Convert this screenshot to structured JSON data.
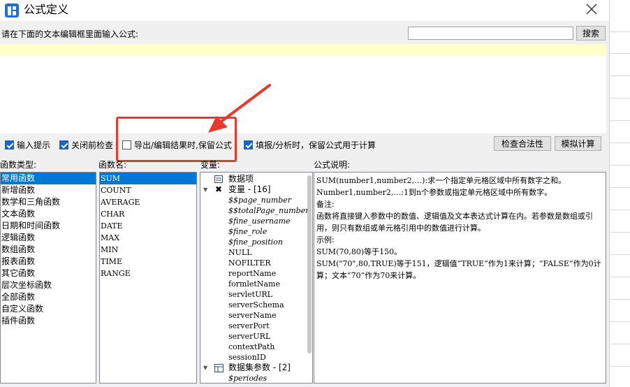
{
  "window": {
    "title": "公式定义"
  },
  "prompt": "请在下面的文本编辑框里面输入公式:",
  "search": {
    "value": "",
    "placeholder": "",
    "button": "搜索"
  },
  "options": {
    "input_hint": {
      "label": "输入提示",
      "checked": true
    },
    "check_before_close": {
      "label": "关闭前检查",
      "checked": true
    },
    "keep_formula_export": {
      "label": "导出/编辑结果时,保留公式",
      "checked": false
    },
    "keep_formula_fill": {
      "label": "填报/分析时，保留公式用于计算",
      "checked": true
    }
  },
  "buttons": {
    "check_validity": "检查合法性",
    "simulate": "模拟计算"
  },
  "headers": {
    "func_type": "函数类型:",
    "func_name": "函数名:",
    "variable": "变量:",
    "formula_desc": "公式说明:"
  },
  "func_types": [
    "常用函数",
    "新增函数",
    "数学和三角函数",
    "文本函数",
    "日期和时间函数",
    "逻辑函数",
    "数组函数",
    "报表函数",
    "其它函数",
    "层次坐标函数",
    "全部函数",
    "自定义函数",
    "插件函数"
  ],
  "func_names": [
    "SUM",
    "COUNT",
    "AVERAGE",
    "CHAR",
    "DATE",
    "MAX",
    "MIN",
    "TIME",
    "RANGE"
  ],
  "variables": {
    "data_item": "数据项",
    "var_group": "变量 - [16]",
    "vars": [
      "$$page_number",
      "$$totalPage_number",
      "$fine_username",
      "$fine_role",
      "$fine_position",
      "NULL",
      "NOFILTER",
      "reportName",
      "formletName",
      "servletURL",
      "serverSchema",
      "serverName",
      "serverPort",
      "serverURL",
      "contextPath",
      "sessionID"
    ],
    "dataset_group": "数据集参数 - [2]",
    "dataset_params": [
      "$periodes"
    ]
  },
  "description": [
    "SUM(number1,number2,…):求一个指定单元格区域中所有数字之和。",
    "Number1,number2,…:1到n个参数或指定单元格区域中所有数字。",
    "备注:",
    "函数将直接键入参数中的数值、逻辑值及文本表达式计算在内。若参数是数组或引用，则只有数组或单元格引用中的数值进行计算。",
    "示例:",
    "SUM(70,80)等于150。",
    "SUM(\"70\",80,TRUE)等于151，逻辑值“TRUE”作为1来计算；“FALSE”作为0计算；文本“70”作为70来计算。"
  ],
  "colors": {
    "selection": "#0078d7",
    "annotation": "#e8392a",
    "editor_highlight": "#ffffc8",
    "checkbox": "#0f67c7"
  }
}
